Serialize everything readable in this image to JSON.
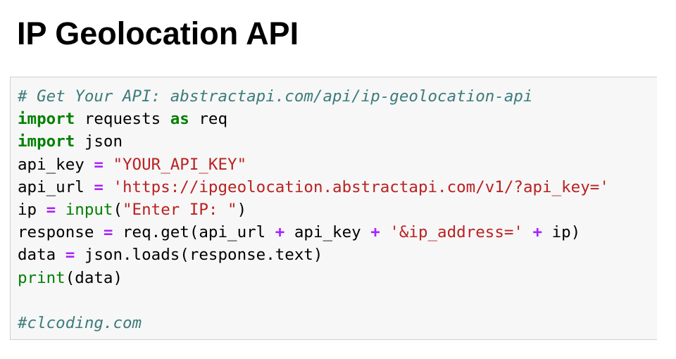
{
  "page": {
    "title": "IP Geolocation API"
  },
  "code_cell": {
    "language": "python",
    "lines": [
      [
        {
          "text": "# Get Your API: abstractapi.com/api/ip-geolocation-api",
          "kind": "comment"
        }
      ],
      [
        {
          "text": "import",
          "kind": "kw"
        },
        {
          "text": " requests ",
          "kind": "plain"
        },
        {
          "text": "as",
          "kind": "kw"
        },
        {
          "text": " req",
          "kind": "plain"
        }
      ],
      [
        {
          "text": "import",
          "kind": "kw"
        },
        {
          "text": " json",
          "kind": "plain"
        }
      ],
      [
        {
          "text": "api_key ",
          "kind": "plain"
        },
        {
          "text": "=",
          "kind": "op"
        },
        {
          "text": " ",
          "kind": "plain"
        },
        {
          "text": "\"YOUR_API_KEY\"",
          "kind": "str"
        }
      ],
      [
        {
          "text": "api_url ",
          "kind": "plain"
        },
        {
          "text": "=",
          "kind": "op"
        },
        {
          "text": " ",
          "kind": "plain"
        },
        {
          "text": "'https://ipgeolocation.abstractapi.com/v1/?api_key='",
          "kind": "str"
        }
      ],
      [
        {
          "text": "ip ",
          "kind": "plain"
        },
        {
          "text": "=",
          "kind": "op"
        },
        {
          "text": " ",
          "kind": "plain"
        },
        {
          "text": "input",
          "kind": "builtin"
        },
        {
          "text": "(",
          "kind": "plain"
        },
        {
          "text": "\"Enter IP: \"",
          "kind": "str"
        },
        {
          "text": ")",
          "kind": "plain"
        }
      ],
      [
        {
          "text": "response ",
          "kind": "plain"
        },
        {
          "text": "=",
          "kind": "op"
        },
        {
          "text": " req.get(api_url ",
          "kind": "plain"
        },
        {
          "text": "+",
          "kind": "op"
        },
        {
          "text": " api_key ",
          "kind": "plain"
        },
        {
          "text": "+",
          "kind": "op"
        },
        {
          "text": " ",
          "kind": "plain"
        },
        {
          "text": "'&ip_address='",
          "kind": "str"
        },
        {
          "text": " ",
          "kind": "plain"
        },
        {
          "text": "+",
          "kind": "op"
        },
        {
          "text": " ip)",
          "kind": "plain"
        }
      ],
      [
        {
          "text": "data ",
          "kind": "plain"
        },
        {
          "text": "=",
          "kind": "op"
        },
        {
          "text": " json.loads(response.text)",
          "kind": "plain"
        }
      ],
      [
        {
          "text": "print",
          "kind": "builtin"
        },
        {
          "text": "(data)",
          "kind": "plain"
        }
      ],
      [],
      [
        {
          "text": "#clcoding.com",
          "kind": "comment"
        }
      ]
    ]
  }
}
